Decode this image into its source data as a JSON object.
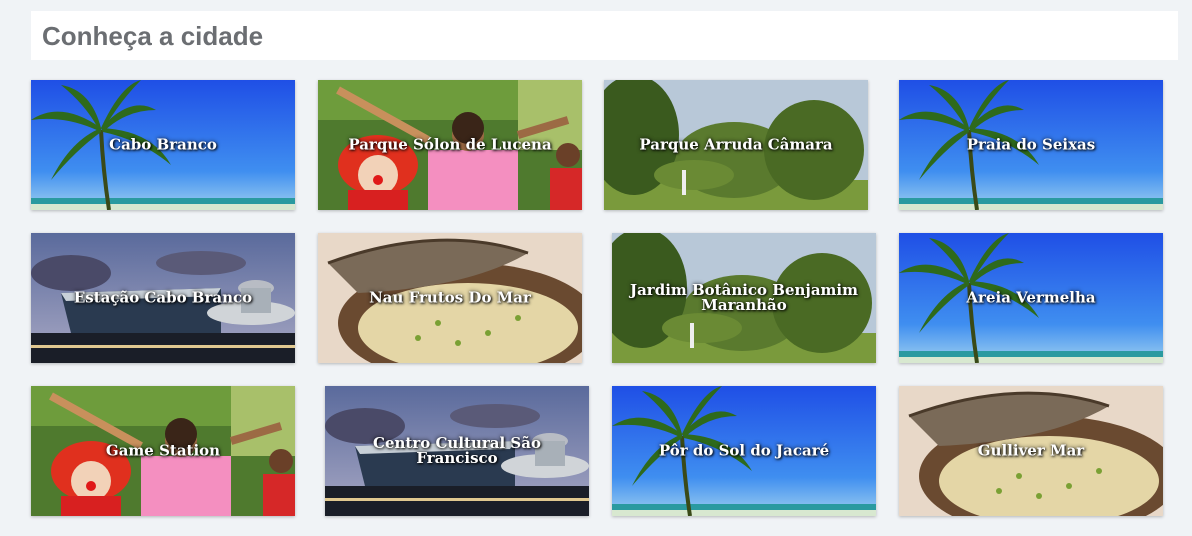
{
  "page": {
    "title": "Conheça a cidade"
  },
  "cards": [
    {
      "label": "Cabo Branco",
      "image": "beach-palm"
    },
    {
      "label": "Parque Sólon de Lucena",
      "image": "clown-kids"
    },
    {
      "label": "Parque Arruda Câmara",
      "image": "park-trees"
    },
    {
      "label": "Praia do Seixas",
      "image": "beach-palm"
    },
    {
      "label": "Estação Cabo Branco",
      "image": "building-dusk"
    },
    {
      "label": "Nau Frutos Do Mar",
      "image": "rice-dish"
    },
    {
      "label": "Jardim Botânico Benjamim Maranhão",
      "image": "park-trees"
    },
    {
      "label": "Areia Vermelha",
      "image": "beach-palm"
    },
    {
      "label": "Game Station",
      "image": "clown-kids"
    },
    {
      "label": "Centro Cultural São Francisco",
      "image": "building-dusk"
    },
    {
      "label": "Pôr do Sol do Jacaré",
      "image": "beach-palm"
    },
    {
      "label": "Gulliver Mar",
      "image": "rice-dish"
    }
  ]
}
